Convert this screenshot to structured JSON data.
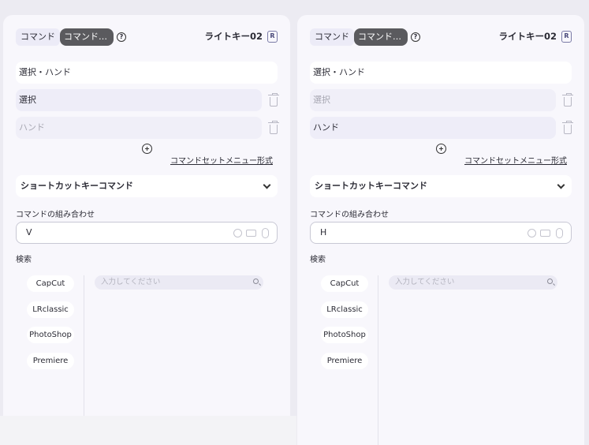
{
  "panels": [
    {
      "tabs": {
        "command": "コマンド",
        "command_set": "コマンドセット"
      },
      "help_icon": "?",
      "device_name": "ライトキー02",
      "device_badge": "R",
      "command_name": "選択・ハンド",
      "commands": [
        {
          "label": "選択",
          "active": true
        },
        {
          "label": "ハンド",
          "active": false
        }
      ],
      "menu_format_link": "コマンドセットメニュー形式",
      "command_type": "ショートカットキーコマンド",
      "combo_label": "コマンドの組み合わせ",
      "combo_value": "V",
      "search_label": "検索",
      "apps": [
        "CapCut",
        "LRclassic",
        "PhotoShop",
        "Premiere"
      ],
      "search_placeholder": "入力してください"
    },
    {
      "tabs": {
        "command": "コマンド",
        "command_set": "コマンドセット"
      },
      "help_icon": "?",
      "device_name": "ライトキー02",
      "device_badge": "R",
      "command_name": "選択・ハンド",
      "commands": [
        {
          "label": "選択",
          "active": false
        },
        {
          "label": "ハンド",
          "active": true
        }
      ],
      "menu_format_link": "コマンドセットメニュー形式",
      "command_type": "ショートカットキーコマンド",
      "combo_label": "コマンドの組み合わせ",
      "combo_value": "H",
      "search_label": "検索",
      "apps": [
        "CapCut",
        "LRclassic",
        "PhotoShop",
        "Premiere"
      ],
      "search_placeholder": "入力してください"
    }
  ],
  "colors": {
    "active_tab": "#5a5a5e",
    "panel_bg": "#f8f7fc",
    "item_bg": "#eeedf8",
    "muted_text": "#a7a7b2"
  }
}
